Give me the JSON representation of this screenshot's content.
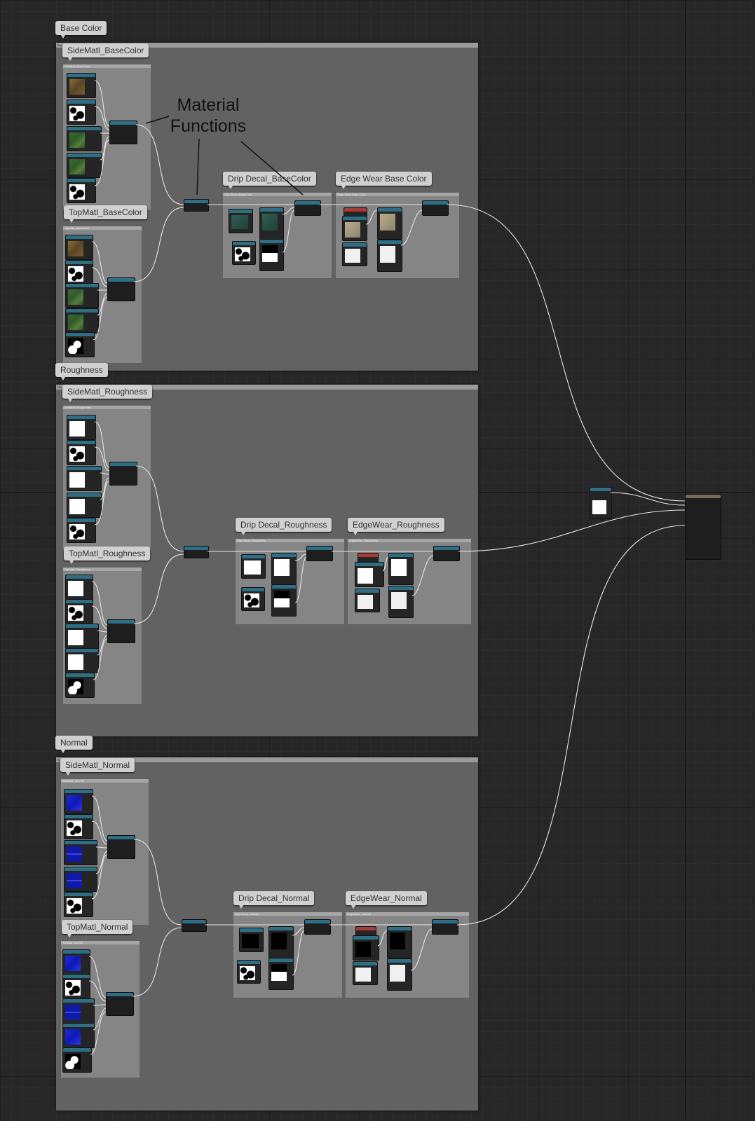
{
  "annotation": {
    "line1": "Material",
    "line2": "Functions"
  },
  "sections": [
    {
      "label": "Base Color",
      "header": "Base Color",
      "side": {
        "label": "SideMatl_BaseColor",
        "header": "SideMatl_BaseColor"
      },
      "top": {
        "label": "TopMatl_BaseColor",
        "header": "TopMatl_BaseColor"
      },
      "drip": {
        "label": "Drip Decal_BaseColor",
        "header": "Drip Decal_BaseColor"
      },
      "edge": {
        "label": "Edge Wear Base Color",
        "header": "Edge Wear Base Color"
      }
    },
    {
      "label": "Roughness",
      "header": "Roughness",
      "side": {
        "label": "SideMatl_Roughness",
        "header": "SideMatl_Roughness"
      },
      "top": {
        "label": "TopMatl_Roughness",
        "header": "TopMatl_Roughness"
      },
      "drip": {
        "label": "Drip Decal_Roughness",
        "header": "Drip Decal_Roughness"
      },
      "edge": {
        "label": "EdgeWear_Roughness",
        "header": "EdgeWear_Roughness"
      }
    },
    {
      "label": "Normal",
      "header": "Normal",
      "side": {
        "label": "SideMatl_Normal",
        "header": "SideMatl_Normal"
      },
      "top": {
        "label": "TopMatl_Normal",
        "header": "TopMatl_Normal"
      },
      "drip": {
        "label": "Drip Decal_Normal",
        "header": "Drip Decal_Normal"
      },
      "edge": {
        "label": "EdgeWear_Normal",
        "header": "EdgeWear_Normal"
      }
    }
  ],
  "colors": {
    "wire": "#e6e6e6",
    "node_header": "#2f6f86",
    "param_red": "#a83a3a"
  }
}
